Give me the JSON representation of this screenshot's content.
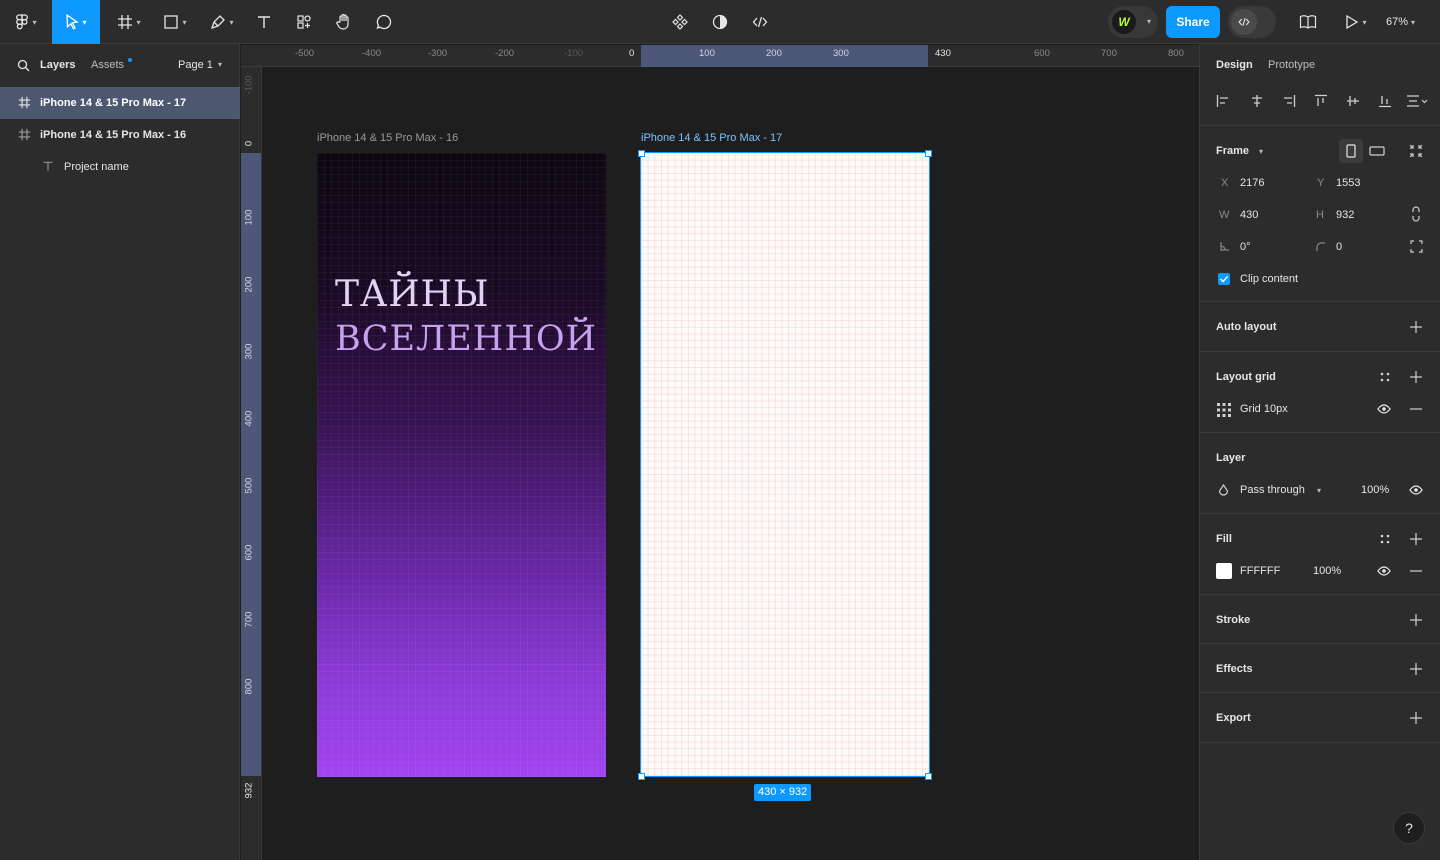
{
  "toolbar": {
    "share_label": "Share",
    "zoom_label": "67%",
    "avatar_initial": "W"
  },
  "left_panel": {
    "tabs": {
      "layers": "Layers",
      "assets": "Assets",
      "page": "Page 1"
    },
    "layers": [
      {
        "name": "iPhone 14 & 15 Pro Max - 17",
        "icon": "frame-icon",
        "selected": true
      },
      {
        "name": "iPhone 14 & 15 Pro Max - 16",
        "icon": "frame-icon",
        "selected": false
      },
      {
        "name": "Project name",
        "icon": "text-icon",
        "selected": false
      }
    ]
  },
  "rulers": {
    "top": [
      "-500",
      "-400",
      "-300",
      "-200",
      "-100",
      "0",
      "100",
      "200",
      "300",
      "430",
      "600",
      "700",
      "800"
    ],
    "left": [
      "-100",
      "0",
      "100",
      "200",
      "300",
      "400",
      "500",
      "600",
      "700",
      "800",
      "932"
    ]
  },
  "canvas": {
    "frame16": {
      "label": "iPhone 14 & 15 Pro Max - 16",
      "title_line1": "ТАЙНЫ",
      "title_line2": "ВСЕЛЕННОЙ"
    },
    "frame17": {
      "label": "iPhone 14 & 15 Pro Max - 17",
      "size_badge": "430 × 932"
    }
  },
  "right_panel": {
    "tabs": {
      "design": "Design",
      "prototype": "Prototype"
    },
    "frame": {
      "title": "Frame",
      "x_label": "X",
      "x_value": "2176",
      "y_label": "Y",
      "y_value": "1553",
      "w_label": "W",
      "w_value": "430",
      "h_label": "H",
      "h_value": "932",
      "rotation_value": "0°",
      "radius_value": "0",
      "clip_content_label": "Clip content"
    },
    "auto_layout": {
      "title": "Auto layout"
    },
    "layout_grid": {
      "title": "Layout grid",
      "item_label": "Grid 10px"
    },
    "layer": {
      "title": "Layer",
      "blend_mode": "Pass through",
      "opacity": "100%"
    },
    "fill": {
      "title": "Fill",
      "hex": "FFFFFF",
      "opacity": "100%"
    },
    "stroke": {
      "title": "Stroke"
    },
    "effects": {
      "title": "Effects"
    },
    "export": {
      "title": "Export"
    }
  },
  "help_label": "?",
  "colors": {
    "accent": "#0d99ff",
    "selection_bg": "#4d5870",
    "gradient_top": "#0d0712",
    "gradient_bottom": "#a044f0",
    "title_text": "#cdb8f2"
  }
}
